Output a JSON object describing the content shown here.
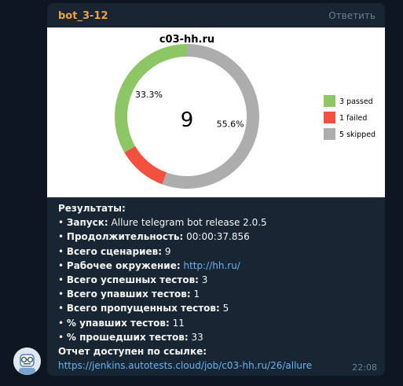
{
  "message": {
    "sender": "bot_3-12",
    "reply_label": "Ответить",
    "time": "22:08"
  },
  "colors": {
    "passed": "#8cc665",
    "failed": "#f4503f",
    "skipped": "#adadad",
    "sender": "#f0a14b",
    "link": "#6ab3f3"
  },
  "chart_data": {
    "type": "pie",
    "style": "donut",
    "title": "c03-hh.ru",
    "center_label": "9",
    "slices": [
      {
        "name": "passed",
        "value": 3,
        "percent_label": "33.3%",
        "legend": "3 passed"
      },
      {
        "name": "failed",
        "value": 1,
        "percent_label": "",
        "legend": "1 failed"
      },
      {
        "name": "skipped",
        "value": 5,
        "percent_label": "55.6%",
        "legend": "5 skipped"
      }
    ],
    "legend_placement": "right"
  },
  "report": {
    "heading": "Результаты:",
    "rows": [
      {
        "key": "Запуск:",
        "value": "Allure telegram bot release 2.0.5"
      },
      {
        "key": "Продолжительность:",
        "value": "00:00:37.856"
      },
      {
        "key": "Всего сценариев:",
        "value": "9"
      },
      {
        "key": "Рабочее окружение:",
        "value": "http://hh.ru/",
        "link": true
      },
      {
        "key": "Всего успешных тестов:",
        "value": "3"
      },
      {
        "key": "Всего упавших тестов:",
        "value": "1"
      },
      {
        "key": "Всего пропущенных тестов:",
        "value": "5"
      },
      {
        "key": "% упавших тестов:",
        "value": "11"
      },
      {
        "key": "% прошедших тестов:",
        "value": "33"
      }
    ],
    "report_link_label": "Отчет доступен по ссылке:",
    "report_url": "https://jenkins.autotests.cloud/job/c03-hh.ru/26/allure"
  },
  "avatar": {
    "icon": "bot-avatar-icon"
  }
}
